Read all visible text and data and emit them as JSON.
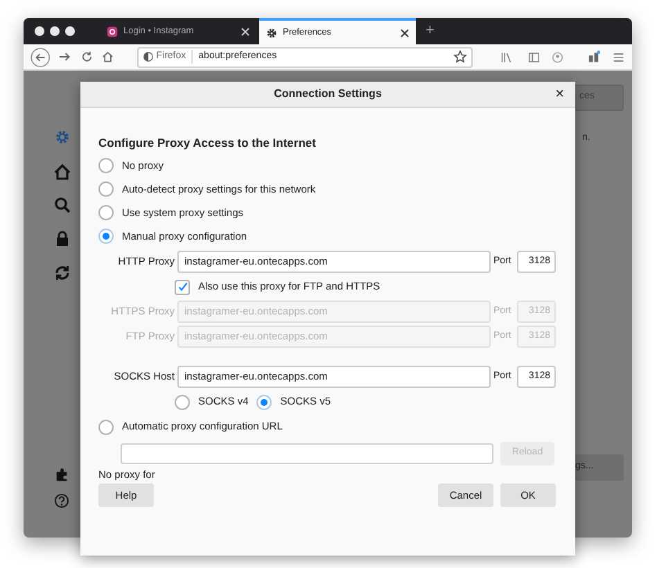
{
  "tabs": [
    {
      "title": "Login • Instagram",
      "selected": false
    },
    {
      "title": "Preferences",
      "selected": true
    }
  ],
  "new_tab": "+",
  "address_bar": {
    "identity": "Firefox",
    "url": "about:preferences"
  },
  "background": {
    "top_button": "ces",
    "note": "n.",
    "bottom_button": "gs..."
  },
  "dialog": {
    "title": "Connection Settings",
    "close": "×",
    "heading": "Configure Proxy Access to the Internet",
    "modes": [
      {
        "label": "No proxy",
        "selected": false
      },
      {
        "label": "Auto-detect proxy settings for this network",
        "selected": false
      },
      {
        "label": "Use system proxy settings",
        "selected": false
      },
      {
        "label": "Manual proxy configuration",
        "selected": true
      }
    ],
    "proxies": [
      {
        "label": "HTTP Proxy",
        "value": "instagramer-eu.ontecapps.com",
        "port_label": "Port",
        "port": "3128",
        "disabled": false
      },
      {
        "label": "HTTPS Proxy",
        "value": "instagramer-eu.ontecapps.com",
        "port_label": "Port",
        "port": "3128",
        "disabled": true
      },
      {
        "label": "FTP Proxy",
        "value": "instagramer-eu.ontecapps.com",
        "port_label": "Port",
        "port": "3128",
        "disabled": true
      },
      {
        "label": "SOCKS Host",
        "value": "instagramer-eu.ontecapps.com",
        "port_label": "Port",
        "port": "3128",
        "disabled": false
      }
    ],
    "share_proxy": {
      "label": "Also use this proxy for FTP and HTTPS",
      "checked": true
    },
    "socks_versions": [
      {
        "label": "SOCKS v4",
        "selected": false
      },
      {
        "label": "SOCKS v5",
        "selected": true
      }
    ],
    "auto_config": {
      "label": "Automatic proxy configuration URL",
      "selected": false
    },
    "reload_button": {
      "label": "Reload",
      "disabled": true
    },
    "no_proxy_label": "No proxy for",
    "buttons": [
      {
        "label": "Help"
      },
      {
        "label": "Cancel"
      },
      {
        "label": "OK"
      }
    ]
  }
}
